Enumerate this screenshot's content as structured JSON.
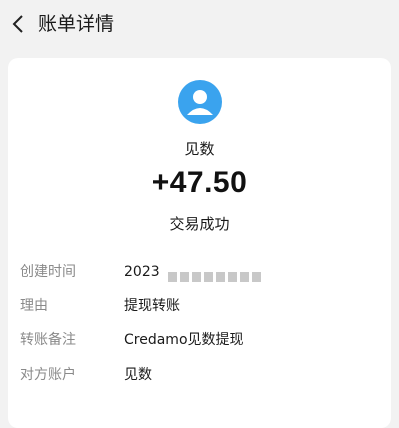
{
  "header": {
    "title": "账单详情"
  },
  "payee": {
    "name": "见数"
  },
  "transaction": {
    "amount": "+47.50",
    "status": "交易成功"
  },
  "details": [
    {
      "label": "创建时间",
      "value": "2023"
    },
    {
      "label": "理由",
      "value": "提现转账"
    },
    {
      "label": "转账备注",
      "value": "Credamo见数提现"
    },
    {
      "label": "对方账户",
      "value": "见数"
    }
  ],
  "colors": {
    "avatar_bg": "#3aa3ee",
    "page_bg": "#f2f2f2",
    "card_bg": "#ffffff"
  },
  "icons": {
    "back": "chevron-left-icon",
    "avatar": "user-avatar-icon"
  }
}
